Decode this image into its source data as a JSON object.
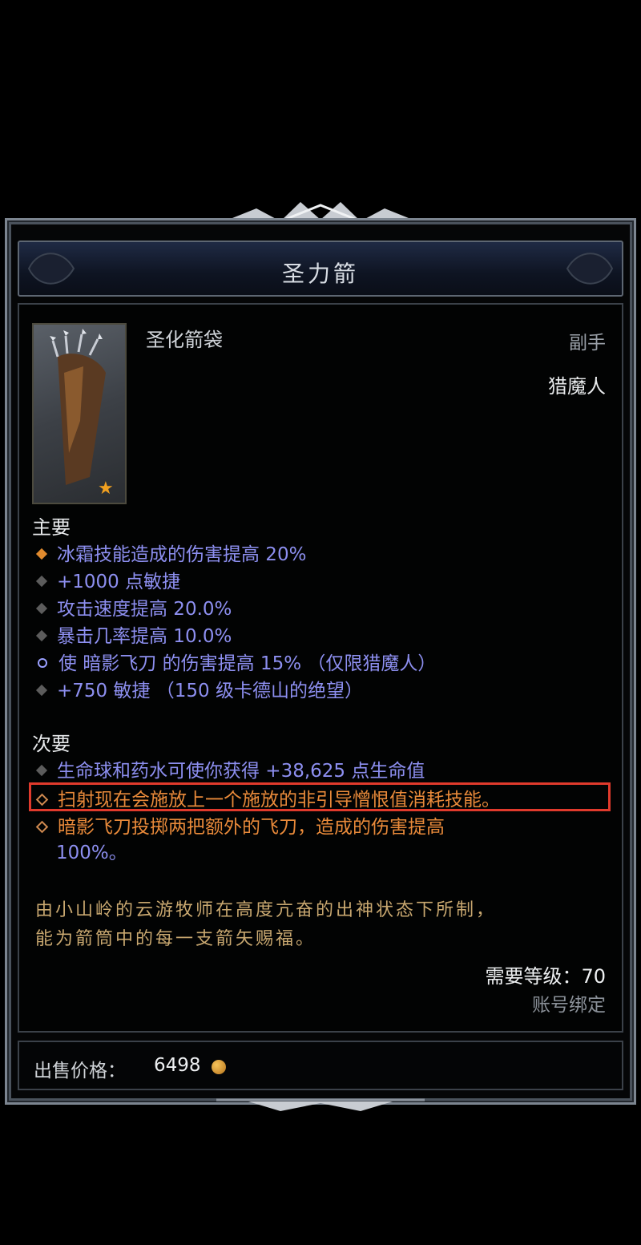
{
  "title": "圣力箭",
  "item_type": "圣化箭袋",
  "slot": "副手",
  "class": "猎魔人",
  "primary": {
    "label": "主要",
    "stats": [
      {
        "text": "冰霜技能造成的伤害提高 20%",
        "bullet": "orange"
      },
      {
        "text": "+1000 点敏捷",
        "bullet": "gray"
      },
      {
        "text": "攻击速度提高 20.0%",
        "bullet": "gray"
      },
      {
        "text": "暴击几率提高 10.0%",
        "bullet": "gray"
      },
      {
        "text": "使 暗影飞刀 的伤害提高 15% （仅限猎魔人）",
        "bullet": "cycle"
      },
      {
        "text": "+750 敏捷 （150 级卡德山的绝望）",
        "bullet": "gray"
      }
    ]
  },
  "secondary": {
    "label": "次要",
    "stats": [
      {
        "text": "生命球和药水可使你获得 +38,625 点生命值",
        "bullet": "gray"
      },
      {
        "text": "扫射现在会施放上一个施放的非引导憎恨值消耗技能。",
        "bullet": "hollow"
      },
      {
        "text": "暗影飞刀投掷两把额外的飞刀，造成的伤害提高",
        "bullet": "hollow"
      },
      {
        "text": "100%。",
        "bullet": "none"
      }
    ]
  },
  "flavor": [
    "由小山岭的云游牧师在高度亢奋的出神状态下所制，",
    "能为箭筒中的每一支箭矢赐福。"
  ],
  "requirement": "需要等级：70",
  "binding": "账号绑定",
  "price_label": "出售价格：",
  "price_value": "6498",
  "colors": {
    "magic_blue": "#8d8ff0",
    "legendary_orange": "#e98a3a",
    "highlight_red": "#e03a2c"
  },
  "icons": {
    "item": "quiver-icon",
    "star": "star-icon",
    "currency": "gold-coin-icon"
  }
}
